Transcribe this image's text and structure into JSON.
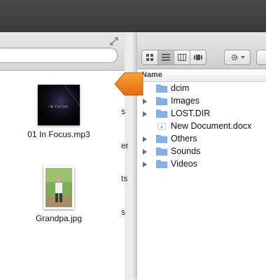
{
  "left_window": {
    "files": [
      {
        "label": "01 In Focus.mp3",
        "icon": "audio-album-art-icon",
        "art_text": "IN FOCUS"
      },
      {
        "label": "Grandpa.jpg",
        "icon": "photo-thumbnail-icon"
      }
    ]
  },
  "backdrop_fragments": [
    "s",
    "er",
    "ts",
    "s"
  ],
  "finder": {
    "column_header": "Name",
    "view_buttons": [
      "icon-view-icon",
      "list-view-icon",
      "column-view-icon",
      "coverflow-view-icon"
    ],
    "items": [
      {
        "name": "dcim",
        "type": "folder",
        "expandable": false
      },
      {
        "name": "Images",
        "type": "folder",
        "expandable": true
      },
      {
        "name": "LOST.DIR",
        "type": "folder",
        "expandable": true
      },
      {
        "name": "New Document.docx",
        "type": "document",
        "expandable": false
      },
      {
        "name": "Others",
        "type": "folder",
        "expandable": true
      },
      {
        "name": "Sounds",
        "type": "folder",
        "expandable": true
      },
      {
        "name": "Videos",
        "type": "folder",
        "expandable": true
      }
    ]
  },
  "colors": {
    "folder_blue": "#7fb2e5",
    "drag_orange": "#f07e1a",
    "toolbar_gray": "#d8d8d8"
  }
}
